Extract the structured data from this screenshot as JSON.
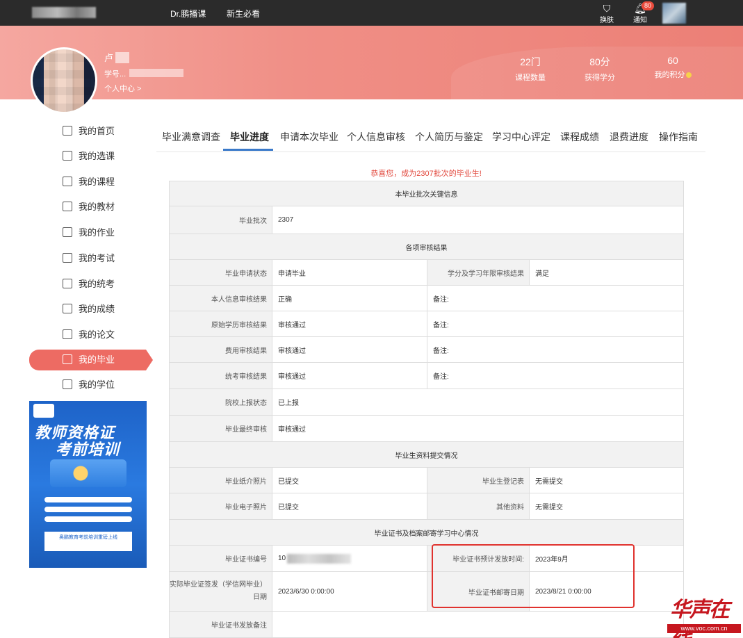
{
  "topbar": {
    "nav": [
      "Dr.鹏播课",
      "新生必看"
    ],
    "skin_label": "换肤",
    "notify_label": "通知",
    "notify_count": "80"
  },
  "profile": {
    "name": "卢",
    "student_no_label": "学号...",
    "center_link": "个人中心 >"
  },
  "stats": [
    {
      "value": "22门",
      "label": "课程数量"
    },
    {
      "value": "80分",
      "label": "获得学分"
    },
    {
      "value": "60",
      "label": "我的积分"
    }
  ],
  "sidebar": {
    "items": [
      {
        "label": "我的首页",
        "icon": "home-icon"
      },
      {
        "label": "我的选课",
        "icon": "select-course-icon"
      },
      {
        "label": "我的课程",
        "icon": "course-icon"
      },
      {
        "label": "我的教材",
        "icon": "textbook-icon"
      },
      {
        "label": "我的作业",
        "icon": "homework-icon"
      },
      {
        "label": "我的考试",
        "icon": "exam-icon"
      },
      {
        "label": "我的统考",
        "icon": "unified-exam-icon"
      },
      {
        "label": "我的成绩",
        "icon": "score-icon"
      },
      {
        "label": "我的论文",
        "icon": "thesis-icon"
      },
      {
        "label": "我的毕业",
        "icon": "graduation-icon"
      },
      {
        "label": "我的学位",
        "icon": "degree-icon"
      }
    ],
    "active_index": 9
  },
  "ad": {
    "title1": "教师资格证",
    "title2": "考前培训",
    "strip": "奥鹏教育考前培训重磅上线"
  },
  "tabs": [
    "毕业满意调查",
    "毕业进度",
    "申请本次毕业",
    "个人信息审核",
    "个人简历与鉴定",
    "学习中心评定",
    "课程成绩",
    "退费进度",
    "操作指南"
  ],
  "active_tab": 1,
  "congrats": "恭喜您，成为2307批次的毕业生!",
  "table": {
    "sec1": "本毕业批次关键信息",
    "batch_label": "毕业批次",
    "batch_value": "2307",
    "sec2": "各项审核结果",
    "grad_status_label": "毕业申请状态",
    "grad_status_value": "申请毕业",
    "credit_label": "学分及学习年限审核结果",
    "credit_value": "满足",
    "personal_label": "本人信息审核结果",
    "personal_value": "正确",
    "edu_label": "原始学历审核结果",
    "edu_value": "审核通过",
    "fee_label": "费用审核结果",
    "fee_value": "审核通过",
    "unified_label": "统考审核结果",
    "unified_value": "审核通过",
    "remark": "备注:",
    "school_label": "院校上报状态",
    "school_value": "已上报",
    "final_label": "毕业最终审核",
    "final_value": "审核通过",
    "sec3": "毕业生资料提交情况",
    "paper_photo_label": "毕业纸介照片",
    "paper_photo_value": "已提交",
    "register_label": "毕业生登记表",
    "register_value": "无需提交",
    "e_photo_label": "毕业电子照片",
    "e_photo_value": "已提交",
    "other_label": "其他资料",
    "other_value": "无需提交",
    "sec4": "毕业证书及档案邮寄学习中心情况",
    "cert_no_label": "毕业证书编号",
    "cert_no_value": "10",
    "expected_label": "毕业证书预计发放时间:",
    "expected_value": "2023年9月",
    "actual_label": "实际毕业证签发（学信网毕业）日期",
    "actual_value": "2023/6/30 0:00:00",
    "mail_label": "毕业证书邮寄日期",
    "mail_value": "2023/8/21 0:00:00",
    "note_label": "毕业证书发放备注"
  },
  "watermark": {
    "text": "华声在线",
    "url": "www.voc.com.cn"
  }
}
